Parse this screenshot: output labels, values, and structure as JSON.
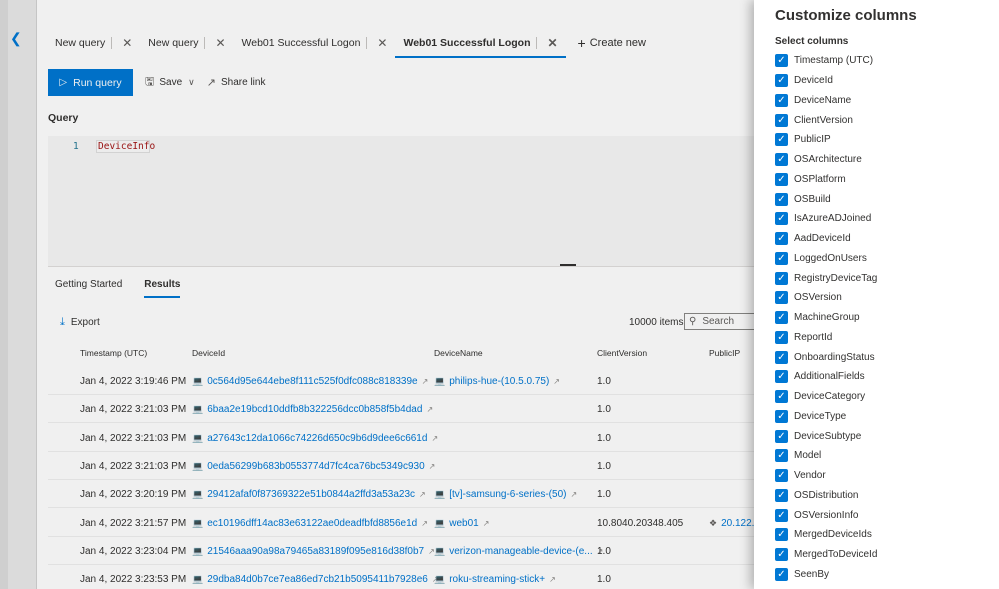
{
  "tabs": [
    {
      "label": "New query",
      "active": false
    },
    {
      "label": "New query",
      "active": false
    },
    {
      "label": "Web01 Successful Logon",
      "active": false
    },
    {
      "label": "Web01 Successful Logon",
      "active": true
    }
  ],
  "create_new_label": "Create new",
  "toolbar": {
    "run_label": "Run query",
    "save_label": "Save",
    "share_label": "Share link"
  },
  "query": {
    "label": "Query",
    "line_number": "1",
    "code": "DeviceInfo"
  },
  "subtabs": {
    "getting_started": "Getting Started",
    "results": "Results"
  },
  "results": {
    "export_label": "Export",
    "count": "10000 items",
    "search_placeholder": "Search",
    "columns": {
      "timestamp": "Timestamp (UTC)",
      "deviceid": "DeviceId",
      "devicename": "DeviceName",
      "clientversion": "ClientVersion",
      "publicip": "PublicIP"
    },
    "rows": [
      {
        "timestamp": "Jan 4, 2022 3:19:46 PM",
        "deviceid": "0c564d95e644ebe8f111c525f0dfc088c818339e",
        "devicename": "philips-hue-(10.5.0.75)",
        "clientversion": "1.0",
        "publicip": ""
      },
      {
        "timestamp": "Jan 4, 2022 3:21:03 PM",
        "deviceid": "6baa2e19bcd10ddfb8b322256dcc0b858f5b4dad",
        "devicename": "",
        "clientversion": "1.0",
        "publicip": ""
      },
      {
        "timestamp": "Jan 4, 2022 3:21:03 PM",
        "deviceid": "a27643c12da1066c74226d650c9b6d9dee6c661d",
        "devicename": "",
        "clientversion": "1.0",
        "publicip": ""
      },
      {
        "timestamp": "Jan 4, 2022 3:21:03 PM",
        "deviceid": "0eda56299b683b0553774d7fc4ca76bc5349c930",
        "devicename": "",
        "clientversion": "1.0",
        "publicip": ""
      },
      {
        "timestamp": "Jan 4, 2022 3:20:19 PM",
        "deviceid": "29412afaf0f87369322e51b0844a2ffd3a53a23c",
        "devicename": "[tv]-samsung-6-series-(50)",
        "clientversion": "1.0",
        "publicip": ""
      },
      {
        "timestamp": "Jan 4, 2022 3:21:57 PM",
        "deviceid": "ec10196dff14ac83e63122ae0deadfbfd8856e1d",
        "devicename": "web01",
        "clientversion": "10.8040.20348.405",
        "publicip": "20.122."
      },
      {
        "timestamp": "Jan 4, 2022 3:23:04 PM",
        "deviceid": "21546aaa90a98a79465a83189f095e816d38f0b7",
        "devicename": "verizon-manageable-device-(e...",
        "clientversion": "1.0",
        "publicip": ""
      },
      {
        "timestamp": "Jan 4, 2022 3:23:53 PM",
        "deviceid": "29dba84d0b7ce7ea86ed7cb21b5095411b7928e6",
        "devicename": "roku-streaming-stick+",
        "clientversion": "1.0",
        "publicip": ""
      }
    ]
  },
  "panel": {
    "title": "Customize columns",
    "subtitle": "Select columns",
    "columns": [
      "Timestamp (UTC)",
      "DeviceId",
      "DeviceName",
      "ClientVersion",
      "PublicIP",
      "OSArchitecture",
      "OSPlatform",
      "OSBuild",
      "IsAzureADJoined",
      "AadDeviceId",
      "LoggedOnUsers",
      "RegistryDeviceTag",
      "OSVersion",
      "MachineGroup",
      "ReportId",
      "OnboardingStatus",
      "AdditionalFields",
      "DeviceCategory",
      "DeviceType",
      "DeviceSubtype",
      "Model",
      "Vendor",
      "OSDistribution",
      "OSVersionInfo",
      "MergedDeviceIds",
      "MergedToDeviceId",
      "SeenBy"
    ]
  },
  "colors": {
    "accent": "#0078d4"
  },
  "icons": {
    "back": "chevron-left-icon",
    "close": "close-icon",
    "run": "play-icon",
    "save": "save-icon",
    "share": "share-icon",
    "export": "download-icon",
    "search": "search-icon",
    "device": "laptop-icon",
    "external": "external-link-icon",
    "ip": "signal-icon",
    "check": "checkmark-icon"
  }
}
